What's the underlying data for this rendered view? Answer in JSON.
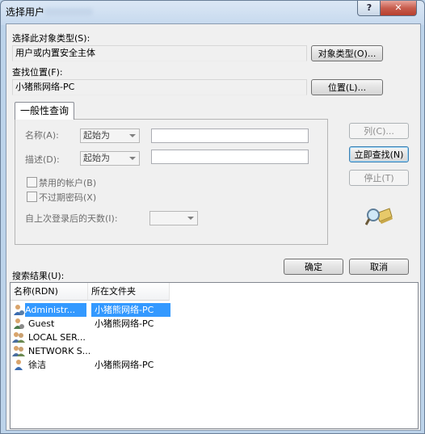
{
  "window": {
    "title": "选择用户",
    "help_label": "?",
    "close_label": "✕"
  },
  "object_type": {
    "label": "选择此对象类型(S):",
    "value": "用户或内置安全主体",
    "button": "对象类型(O)..."
  },
  "location": {
    "label": "查找位置(F):",
    "value": "小猪熊网络-PC",
    "button": "位置(L)..."
  },
  "query": {
    "tab": "一般性查询",
    "name_label": "名称(A):",
    "name_mode": "起始为",
    "desc_label": "描述(D):",
    "desc_mode": "起始为",
    "disabled_accounts": "禁用的帐户(B)",
    "non_expiring_pw": "不过期密码(X)",
    "days_label": "自上次登录后的天数(I):"
  },
  "side_buttons": {
    "columns": "列(C)...",
    "find_now": "立即查找(N)",
    "stop": "停止(T)"
  },
  "ok_label": "确定",
  "cancel_label": "取消",
  "results": {
    "label": "搜索结果(U):",
    "columns": [
      "名称(RDN)",
      "所在文件夹"
    ],
    "rows": [
      {
        "name": "Administr...",
        "folder": "小猪熊网络-PC",
        "icon": "admin-user-icon",
        "selected": true
      },
      {
        "name": "Guest",
        "folder": "小猪熊网络-PC",
        "icon": "guest-user-icon",
        "selected": false
      },
      {
        "name": "LOCAL SER...",
        "folder": "",
        "icon": "group-icon",
        "selected": false
      },
      {
        "name": "NETWORK S...",
        "folder": "",
        "icon": "group-icon",
        "selected": false
      },
      {
        "name": "徐洁",
        "folder": "小猪熊网络-PC",
        "icon": "user-icon",
        "selected": false
      }
    ]
  }
}
